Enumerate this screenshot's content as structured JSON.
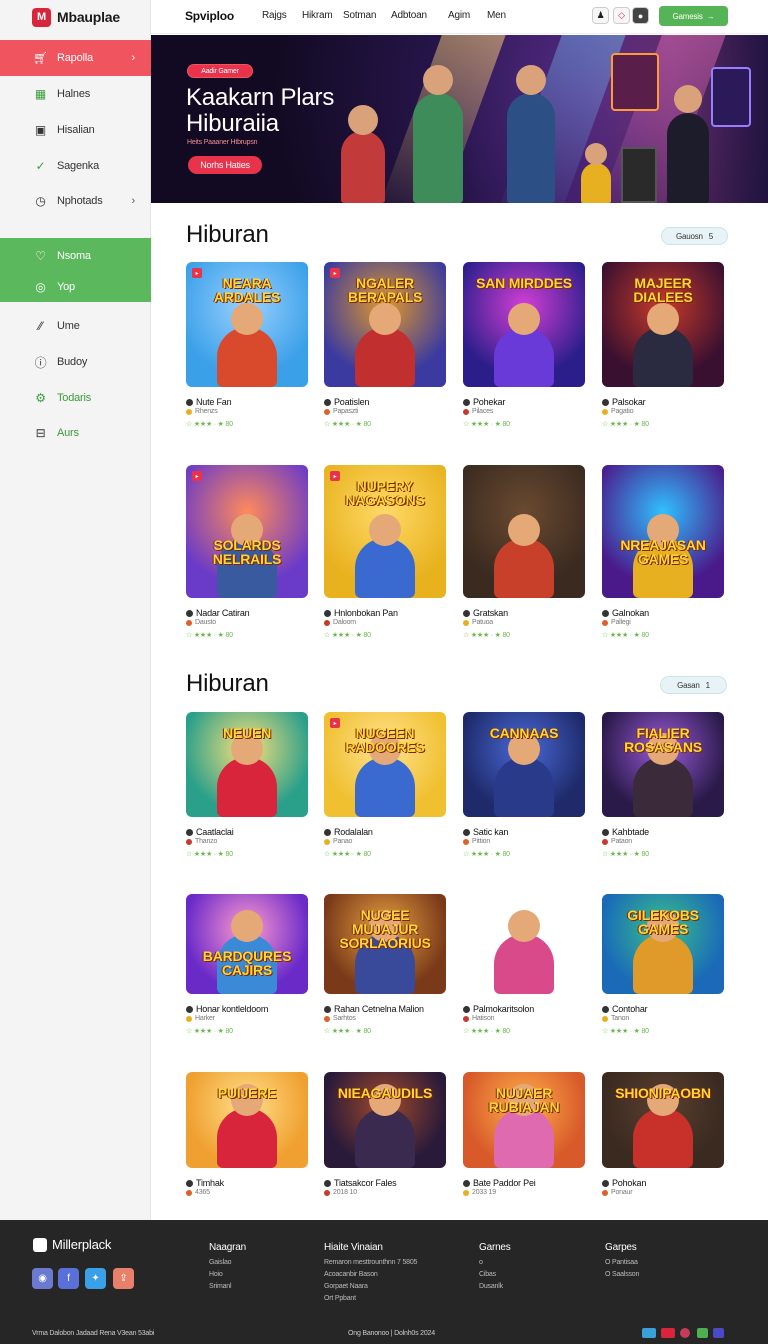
{
  "brand": {
    "logo_text": "Mbauplae",
    "logo_mark": "M"
  },
  "sidebar": {
    "items": [
      {
        "label": "Rapolla",
        "icon": "cart-icon",
        "chevron": "›"
      },
      {
        "label": "Halnes",
        "icon": "grid-icon"
      },
      {
        "label": "Hisalian",
        "icon": "image-icon"
      },
      {
        "label": "Sagenka",
        "icon": "check-icon"
      },
      {
        "label": "Nphotads",
        "icon": "clock-icon",
        "chevron": "›"
      },
      {
        "label": "Nsoma",
        "icon": "heart-icon"
      },
      {
        "label": "Yop",
        "icon": "circle-check-icon"
      },
      {
        "label": "Ume",
        "icon": "pen-icon"
      },
      {
        "label": "Budoy",
        "icon": "info-icon"
      },
      {
        "label": "Todaris",
        "icon": "gear-icon"
      },
      {
        "label": "Aurs",
        "icon": "tray-icon"
      }
    ]
  },
  "topnav": {
    "brand": "Spviploo",
    "links": [
      "Rajgs",
      "Hikram",
      "Sotman",
      "Adbtoan",
      "Agim",
      "Men"
    ],
    "button_label": "Gamesis"
  },
  "hero": {
    "badge": "Aadir Gamer",
    "title": "Kaakarn Plars Hiburaiia",
    "subtitle": "Heits Paaaner Htbrupsn",
    "button": "Norhs Haties"
  },
  "sections": [
    {
      "title": "Hiburan",
      "pill": "Gauosn",
      "pill_num": "5"
    },
    {
      "title": "Hiburan",
      "pill": "Gasan",
      "pill_num": "1"
    }
  ],
  "cards": [
    {
      "art": "NEARA ARDALES",
      "name": "Nute Fan",
      "sub": "Rhenzs",
      "rating": "☆ ★★★ · ★ 80"
    },
    {
      "art": "NGALER BERAPALS",
      "name": "Poatislen",
      "sub": "Papaszti",
      "rating": "☆ ★★★ · ★ 80"
    },
    {
      "art": "SAN MIRDDES",
      "name": "Pohekar",
      "sub": "Pilaces",
      "rating": "☆ ★★★ · ★ 80"
    },
    {
      "art": "MAJEER DIALEES",
      "name": "Palsokar",
      "sub": "Pagatio",
      "rating": "☆ ★★★ · ★ 80"
    },
    {
      "art": "SOLARDS NELRAILS",
      "name": "Nadar Catiran",
      "sub": "Dausto",
      "rating": "☆ ★★★ · ★ 80"
    },
    {
      "art": "NUPERY NAGASONS",
      "name": "Hnlonbokan Pan",
      "sub": "Daloom",
      "rating": "☆ ★★★ · ★ 80"
    },
    {
      "art": "",
      "name": "Gratskan",
      "sub": "Patuoa",
      "rating": "☆ ★★★ · ★ 80"
    },
    {
      "art": "NREAJASAN GAMES",
      "name": "Galnokan",
      "sub": "Pallegi",
      "rating": "☆ ★★★ · ★ 80"
    },
    {
      "art": "NEUEN",
      "name": "Caatlaclai",
      "sub": "Thanzo",
      "rating": "☆ ★★★ · ★ 80"
    },
    {
      "art": "NUGEEN RADOORES",
      "name": "Rodalalan",
      "sub": "Panao",
      "rating": "☆ ★★★ · ★ 80"
    },
    {
      "art": "CANNAAS",
      "name": "Satic kan",
      "sub": "Pittion",
      "rating": "☆ ★★★ · ★ 80"
    },
    {
      "art": "FIALIER ROSASANS",
      "name": "Kahbtade",
      "sub": "Pataon",
      "rating": "☆ ★★★ · ★ 80"
    },
    {
      "art": "BARDQURES CAJIRS",
      "name": "Honar kontleldoom",
      "sub": "Harker",
      "rating": "☆ ★★★ · ★ 80"
    },
    {
      "art": "NUGEE MUJAJUR SORLAORIUS",
      "name": "Rahan Cetnelna Malion",
      "sub": "Sarhtos",
      "rating": "☆ ★★★ · ★ 80"
    },
    {
      "art": "",
      "name": "Palmokaritsolon",
      "sub": "Hatison",
      "rating": "☆ ★★★ · ★ 80"
    },
    {
      "art": "GILEKOBS GAMES",
      "name": "Contohar",
      "sub": "Tanon",
      "rating": "☆ ★★★ · ★ 80"
    },
    {
      "art": "PUIJERE",
      "name": "Timhak",
      "sub": "4365",
      "rating": ""
    },
    {
      "art": "NIEAGAUDILS",
      "name": "Tiatsakcor Fales",
      "sub": "2018 10",
      "rating": ""
    },
    {
      "art": "NUJAER RUBIAJAN",
      "name": "Bate Paddor Pei",
      "sub": "2033 19",
      "rating": ""
    },
    {
      "art": "SHIONIPAOBN",
      "name": "Pohokan",
      "sub": "Ponaur",
      "rating": ""
    }
  ],
  "footer": {
    "logo": "Millerplack",
    "columns": [
      {
        "title": "Naagran",
        "links": [
          "Gaislao",
          "Hoio",
          "Srimanl"
        ]
      },
      {
        "title": "Hiaite Vinaian",
        "links": [
          "Remaron mesttrounthnn 7 5805",
          "Acoacanbir Bason",
          "Gorpaet Naara",
          "Ort Ppbant"
        ]
      },
      {
        "title": "Garnes",
        "links": [
          "o",
          "Cibas",
          "Dusanlk"
        ]
      },
      {
        "title": "Garpes",
        "links": [
          "O Pantisaa",
          "O Saalsson"
        ]
      }
    ],
    "bottom_left": "Vrma Dalobon Jadaad Rena V3ean 53abi",
    "bottom_mid": "Ong Banonoo | Dolnh0s 2024",
    "accent": "#5cb85c",
    "red_accent": "#f0545f"
  }
}
